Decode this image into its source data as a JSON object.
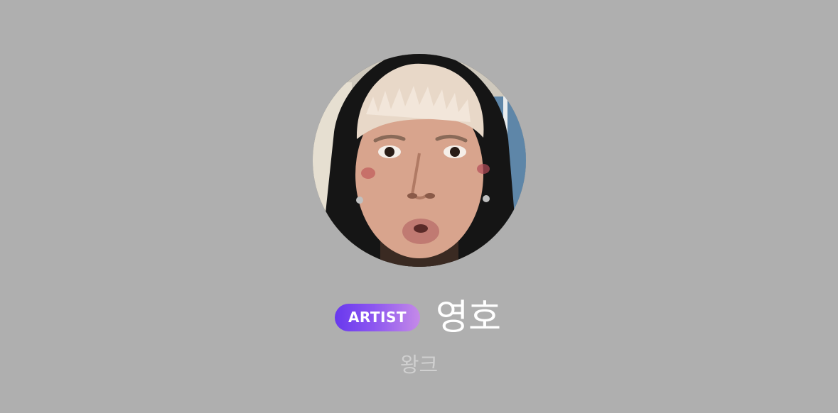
{
  "profile": {
    "badge_label": "ARTIST",
    "artist_name": "영호",
    "group_name": "왕크"
  },
  "colors": {
    "background": "#afafaf",
    "badge_gradient_start": "#6838ee",
    "badge_gradient_end": "#c58ae8",
    "name_text": "#ffffff",
    "group_text": "#d0d0d0"
  }
}
